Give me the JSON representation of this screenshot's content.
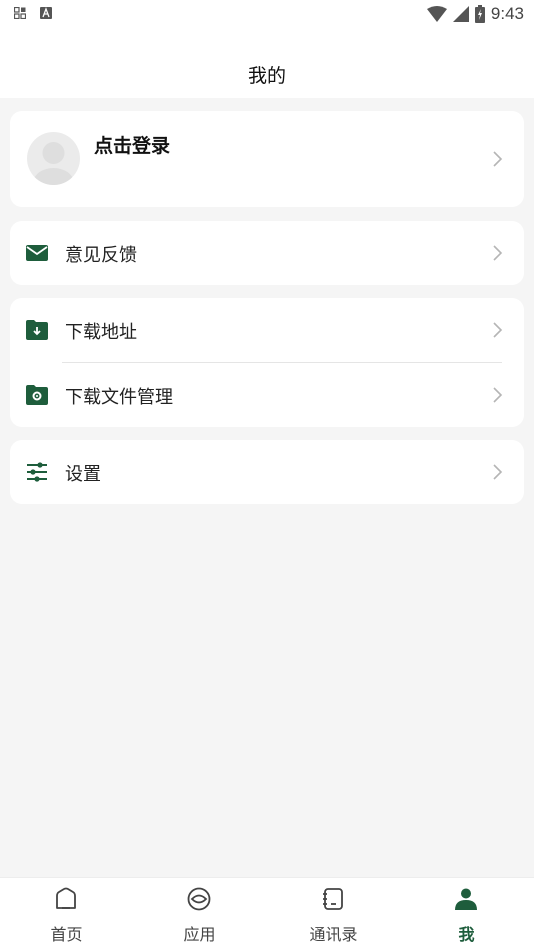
{
  "status_bar": {
    "time": "9:43",
    "left_icons": [
      "notification-app-icon",
      "text-a-icon"
    ],
    "right_icons": [
      "wifi-icon",
      "signal-icon",
      "battery-charging-icon"
    ]
  },
  "header": {
    "title": "我的"
  },
  "profile": {
    "login_label": "点击登录"
  },
  "menu": {
    "feedback": {
      "label": "意见反馈",
      "icon": "mail-icon"
    },
    "download_address": {
      "label": "下载地址",
      "icon": "folder-download-icon"
    },
    "download_manager": {
      "label": "下载文件管理",
      "icon": "folder-gear-icon"
    },
    "settings": {
      "label": "设置",
      "icon": "sliders-icon"
    }
  },
  "tabbar": {
    "tabs": [
      {
        "label": "首页",
        "icon": "home-icon",
        "active": false
      },
      {
        "label": "应用",
        "icon": "app-eye-icon",
        "active": false
      },
      {
        "label": "通讯录",
        "icon": "contacts-book-icon",
        "active": false
      },
      {
        "label": "我",
        "icon": "person-icon",
        "active": true
      }
    ]
  },
  "colors": {
    "accent": "#1e5d3c",
    "background": "#f5f5f5",
    "card": "#ffffff"
  }
}
